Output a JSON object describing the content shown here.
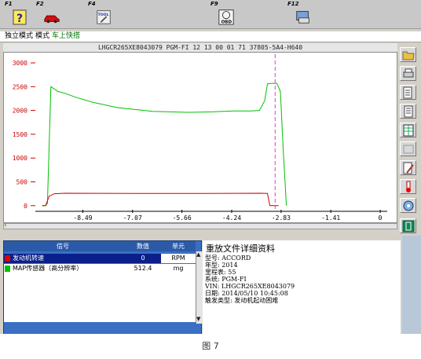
{
  "fkeys": [
    {
      "label": "F1",
      "icon": "help-icon"
    },
    {
      "label": "F2",
      "icon": "car-icon"
    },
    {
      "label": "F4",
      "icon": "tool-icon",
      "text": "TOOL"
    },
    {
      "label": "F9",
      "icon": "obd-icon",
      "text": "OBD"
    },
    {
      "label": "F12",
      "icon": "print-icon"
    }
  ],
  "mode": {
    "part1": "独立模式",
    "part2": "模式",
    "part3": "车上快搭"
  },
  "chart_header": "LHGCR265XE8043079  PGM-FI  12 13 00 01 71  37805-5A4-H640",
  "chart_data": {
    "type": "line",
    "x_ticks": [
      "-8.49",
      "-7.07",
      "-5.66",
      "-4.24",
      "-2.83",
      "-1.41",
      "0"
    ],
    "y_ticks": [
      "0",
      "500",
      "1000",
      "1500",
      "2000",
      "2500",
      "3000"
    ],
    "xlim": [
      -9.8,
      0.2
    ],
    "ylim": [
      -20,
      3050
    ],
    "marker_x": -3.0,
    "series": [
      {
        "color": "#00c000",
        "x": [
          -9.65,
          -9.55,
          -9.5,
          -9.4,
          -9.2,
          -9.0,
          -8.7,
          -8.2,
          -7.5,
          -6.5,
          -5.5,
          -4.8,
          -4.2,
          -3.7,
          -3.45,
          -3.3,
          -3.22,
          -3.1,
          -2.95,
          -2.85,
          -2.77,
          -2.68
        ],
        "y": [
          0,
          0,
          50,
          2500,
          2400,
          2360,
          2280,
          2170,
          2060,
          1980,
          1960,
          1970,
          1990,
          1990,
          2000,
          2200,
          2560,
          2570,
          2570,
          2400,
          1200,
          0
        ]
      },
      {
        "color": "#cc0000",
        "x": [
          -9.65,
          -9.55,
          -9.45,
          -9.3,
          -9.0,
          -7.0,
          -5.0,
          -3.4,
          -3.22,
          -3.15,
          -3.1,
          -2.9
        ],
        "y": [
          0,
          0,
          200,
          250,
          260,
          255,
          255,
          260,
          258,
          0,
          0,
          0
        ]
      }
    ]
  },
  "table": {
    "headers": [
      "信号",
      "数值",
      "单元"
    ],
    "rows": [
      {
        "name": "发动机转速",
        "value": "0",
        "unit": "RPM",
        "color": "#e00000"
      },
      {
        "name": "MAP传感器（高分辨率）",
        "value": "512.4",
        "unit": "mg",
        "color": "#00c000"
      }
    ]
  },
  "details": {
    "title": "重放文件详细资料",
    "lines": [
      "型号: ACCORD",
      "年型: 2014",
      "里程表:  55",
      "系统: PGM-FI",
      "VIN: LHGCR265XE8043079",
      "日期: 2014/05/10 10:45:08",
      "触发类型: 发动机起动困难"
    ]
  },
  "caption": "图 7"
}
